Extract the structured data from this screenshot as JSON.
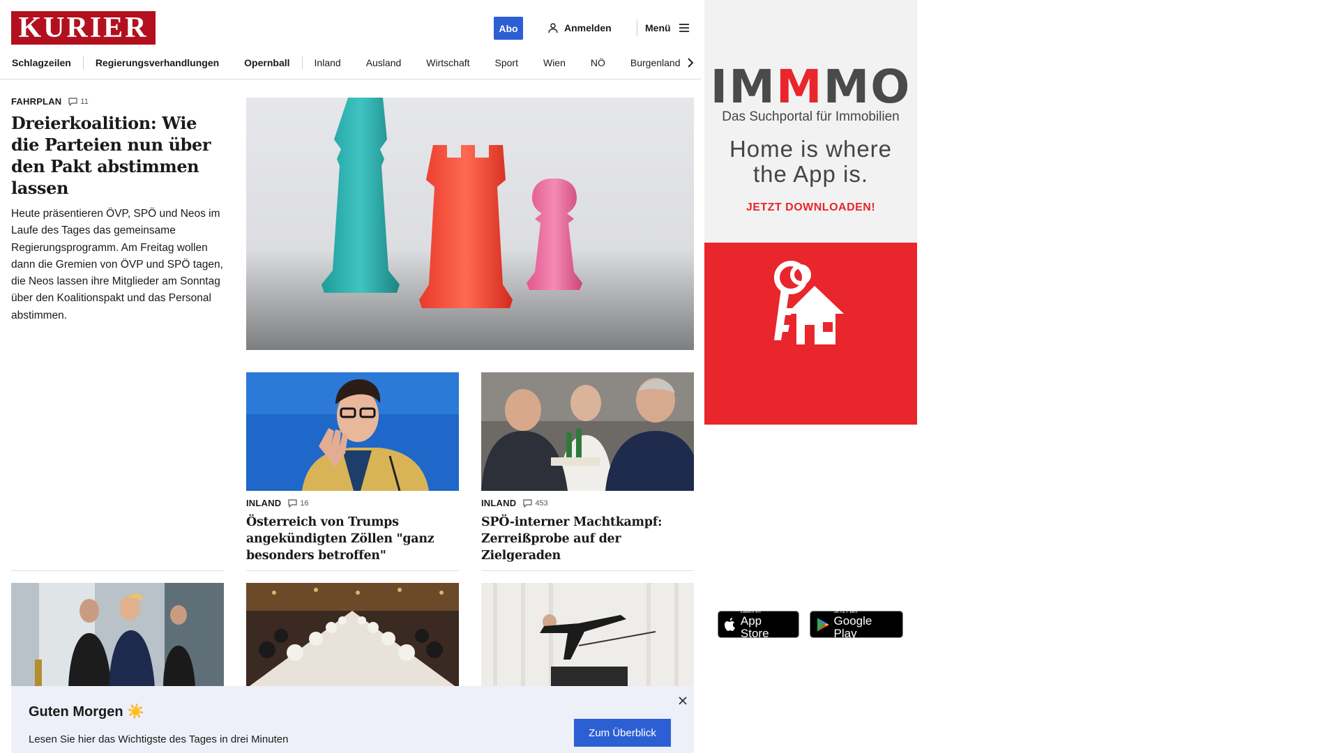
{
  "header": {
    "logo_text": "KURIER",
    "abo_label": "Abo",
    "login_label": "Anmelden",
    "menu_label": "Menü",
    "nav": {
      "items": [
        "Schlagzeilen",
        "Regierungsverhandlungen",
        "Opernball",
        "Inland",
        "Ausland",
        "Wirtschaft",
        "Sport",
        "Wien",
        "NÖ",
        "Burgenland"
      ]
    }
  },
  "lead": {
    "kicker": "FAHRPLAN",
    "comments": "11",
    "title": "Dreierkoalition: Wie die Parteien nun über den Pakt abstimmen lassen",
    "teaser": "Heute präsentieren ÖVP, SPÖ und Neos im Laufe des Tages das gemeinsame Regierungsprogramm. Am Freitag wollen dann die Gremien von ÖVP und SPÖ tagen, die Neos lassen ihre Mitglieder am Sonntag über den Koalitionspakt und das Personal abstimmen."
  },
  "cards": [
    {
      "kicker": "INLAND",
      "comments": "16",
      "title": "Österreich von Trumps angekündigten Zöllen \"ganz besonders betroffen\""
    },
    {
      "kicker": "INLAND",
      "comments": "453",
      "title": "SPÖ-interner Machtkampf: Zerreißprobe auf der Zielgeraden"
    }
  ],
  "ad": {
    "brand_pre": "IM",
    "brand_mid": "M",
    "brand_post": "MO",
    "subtitle": "Das Suchportal für Immobilien",
    "tagline_1": "Home is where",
    "tagline_2": "the App is.",
    "cta": "JETZT DOWNLOADEN!",
    "appstore_small": "Laden im",
    "appstore_big": "App Store",
    "googleplay_small": "JETZT BEI",
    "googleplay_big": "Google Play",
    "colors": {
      "accent": "#e8262c",
      "text": "#4a4a4a"
    }
  },
  "banner": {
    "title": "Guten Morgen ☀️",
    "text": "Lesen Sie hier das Wichtigste des Tages in drei Minuten",
    "button": "Zum Überblick"
  },
  "colors": {
    "brand": "#b3101f",
    "primary_button": "#2d5fd4"
  }
}
